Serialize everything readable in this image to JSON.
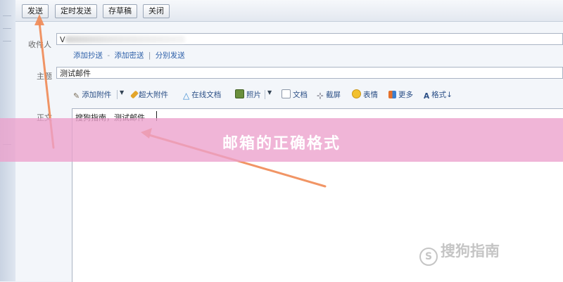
{
  "toolbar": {
    "send": "发送",
    "scheduled_send": "定时发送",
    "save_draft": "存草稿",
    "close": "关闭"
  },
  "form": {
    "to_label": "收件人",
    "to_value_visible": "V",
    "links": {
      "add_cc": "添加抄送",
      "dash": "-",
      "add_bcc": "添加密送",
      "bar": "|",
      "separate_send": "分别发送"
    },
    "subject_label": "主题",
    "subject_value": "测试邮件",
    "body_label": "正文",
    "body_value": "搜狗指南，测试邮件"
  },
  "attachments": {
    "add_attachment": "添加附件",
    "large_attachment": "超大附件",
    "online_doc": "在线文档",
    "photo": "照片",
    "doc": "文档",
    "screenshot": "截屏",
    "emoji": "表情",
    "more": "更多",
    "format": "格式↓"
  },
  "banner": {
    "title": "邮箱的正确格式"
  },
  "watermark": {
    "text": "搜狗指南"
  },
  "colors": {
    "accent_link": "#2b5ea8",
    "annotation_arrow": "#f08a55",
    "banner": "#eca0cc"
  }
}
